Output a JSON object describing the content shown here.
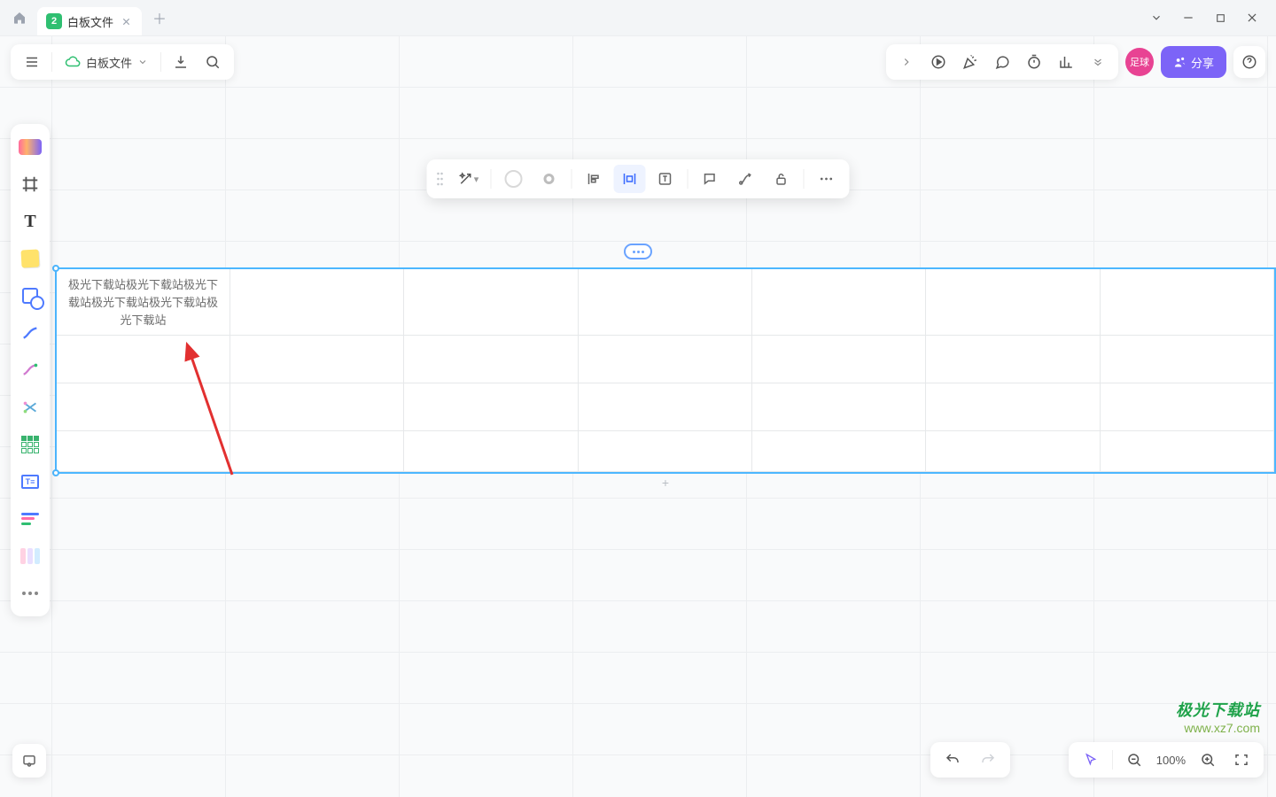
{
  "tabbar": {
    "tab_title": "白板文件",
    "tab_icon_symbol": "2"
  },
  "toolbar": {
    "file_label": "白板文件"
  },
  "topright": {
    "avatar_text": "足球",
    "share_label": "分享"
  },
  "watermark": {
    "line1": "极光下载站",
    "line2": "www.xz7.com"
  },
  "zoombar": {
    "zoom_text": "100%"
  },
  "table": {
    "cell_text": "极光下载站极光下载站极光下载站极光下载站极光下载站极光下载站"
  },
  "icon_names": {
    "home": "home-icon",
    "close": "close-icon",
    "plus": "plus-icon",
    "chevron": "chevron-down-icon",
    "minimize": "minimize-icon",
    "maximize": "maximize-icon",
    "winclose": "window-close-icon",
    "menu": "menu-icon",
    "cloud": "cloud-icon",
    "download": "download-icon",
    "search": "search-icon",
    "play": "play-icon",
    "arrowexp": "expand-icon",
    "chat": "chat-icon",
    "timer": "timer-icon",
    "chart": "chart-icon",
    "help": "help-icon",
    "share": "share-people-icon",
    "undo": "undo-icon",
    "redo": "redo-icon",
    "cursor": "cursor-icon",
    "zoomout": "zoom-out-icon",
    "zoomin": "zoom-in-icon",
    "fit": "fit-screen-icon",
    "locate": "map-pin-icon",
    "grip": "drag-handle-icon",
    "ai": "magic-ai-icon",
    "alignL": "align-left-icon",
    "alignC": "align-center-icon",
    "textT": "text-tool-icon",
    "comment": "comment-icon",
    "link": "connector-icon",
    "unlock": "unlock-icon",
    "more": "more-icon"
  }
}
